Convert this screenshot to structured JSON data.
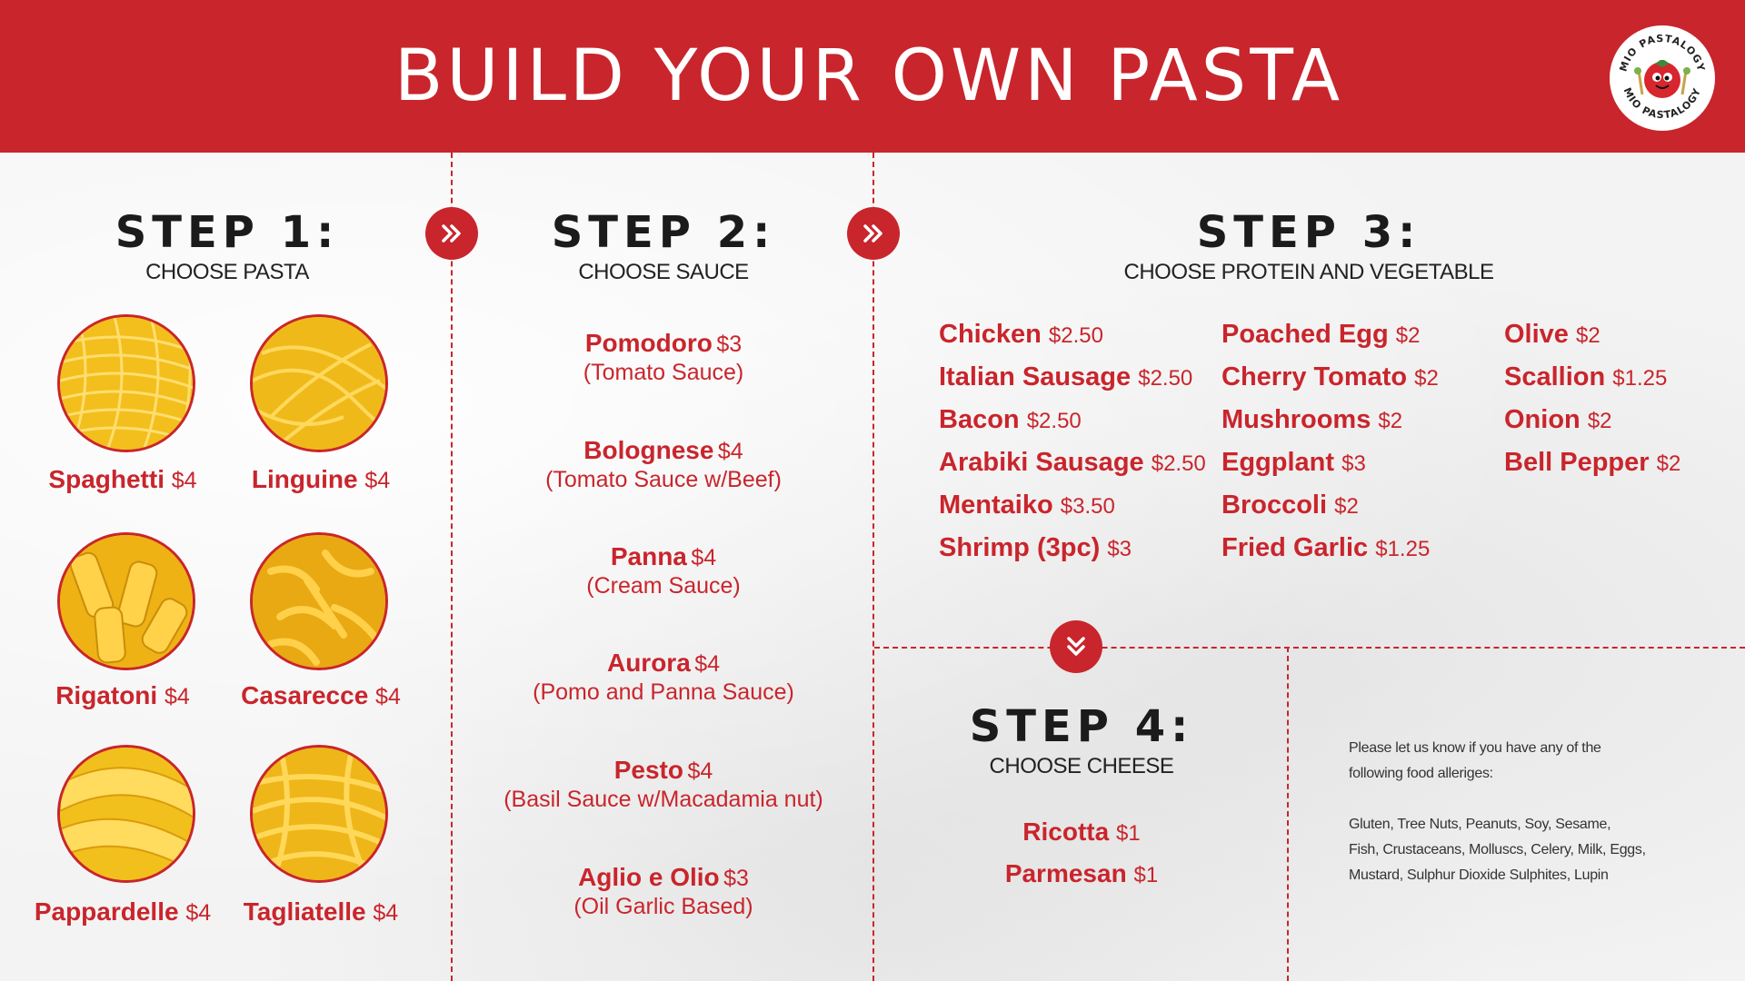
{
  "header": {
    "title": "BUILD YOUR OWN PASTA",
    "logo_text": "MIO PASTALOGY"
  },
  "colors": {
    "accent": "#c9252c",
    "pasta": "#f5c518"
  },
  "step1": {
    "title": "STEP 1:",
    "subtitle": "CHOOSE PASTA",
    "items": [
      {
        "name": "Spaghetti",
        "price": "$4"
      },
      {
        "name": "Linguine",
        "price": "$4"
      },
      {
        "name": "Rigatoni",
        "price": "$4"
      },
      {
        "name": "Casarecce",
        "price": "$4"
      },
      {
        "name": "Pappardelle",
        "price": "$4"
      },
      {
        "name": "Tagliatelle",
        "price": "$4"
      }
    ]
  },
  "step2": {
    "title": "STEP 2:",
    "subtitle": "CHOOSE SAUCE",
    "items": [
      {
        "name": "Pomodoro",
        "price": "$3",
        "desc": "(Tomato Sauce)"
      },
      {
        "name": "Bolognese",
        "price": "$4",
        "desc": "(Tomato Sauce w/Beef)"
      },
      {
        "name": "Panna",
        "price": "$4",
        "desc": "(Cream Sauce)"
      },
      {
        "name": "Aurora",
        "price": "$4",
        "desc": "(Pomo and Panna Sauce)"
      },
      {
        "name": "Pesto",
        "price": "$4",
        "desc": "(Basil Sauce w/Macadamia nut)"
      },
      {
        "name": "Aglio e Olio",
        "price": "$3",
        "desc": "(Oil Garlic Based)"
      }
    ]
  },
  "step3": {
    "title": "STEP 3:",
    "subtitle": "CHOOSE PROTEIN AND VEGETABLE",
    "col1": [
      {
        "name": "Chicken",
        "price": "$2.50"
      },
      {
        "name": "Italian Sausage",
        "price": "$2.50"
      },
      {
        "name": "Bacon",
        "price": "$2.50"
      },
      {
        "name": "Arabiki Sausage",
        "price": "$2.50"
      },
      {
        "name": "Mentaiko",
        "price": "$3.50"
      },
      {
        "name": "Shrimp (3pc)",
        "price": "$3"
      }
    ],
    "col2": [
      {
        "name": "Poached Egg",
        "price": "$2"
      },
      {
        "name": "Cherry Tomato",
        "price": "$2"
      },
      {
        "name": "Mushrooms",
        "price": "$2"
      },
      {
        "name": "Eggplant",
        "price": "$3"
      },
      {
        "name": "Broccoli",
        "price": "$2"
      },
      {
        "name": "Fried Garlic",
        "price": "$1.25"
      }
    ],
    "col3": [
      {
        "name": "Olive",
        "price": "$2"
      },
      {
        "name": "Scallion",
        "price": "$1.25"
      },
      {
        "name": "Onion",
        "price": "$2"
      },
      {
        "name": "Bell Pepper",
        "price": "$2"
      }
    ]
  },
  "step4": {
    "title": "STEP 4:",
    "subtitle": "CHOOSE CHEESE",
    "items": [
      {
        "name": "Ricotta",
        "price": "$1"
      },
      {
        "name": "Parmesan",
        "price": "$1"
      }
    ]
  },
  "allergy": {
    "intro_1": "Please let us know if you have any of the",
    "intro_2": "following food alleriges:",
    "list_1": "Gluten, Tree Nuts, Peanuts, Soy, Sesame,",
    "list_2": "Fish, Crustaceans, Molluscs, Celery, Milk, Eggs,",
    "list_3": "Mustard, Sulphur Dioxide Sulphites, Lupin"
  }
}
